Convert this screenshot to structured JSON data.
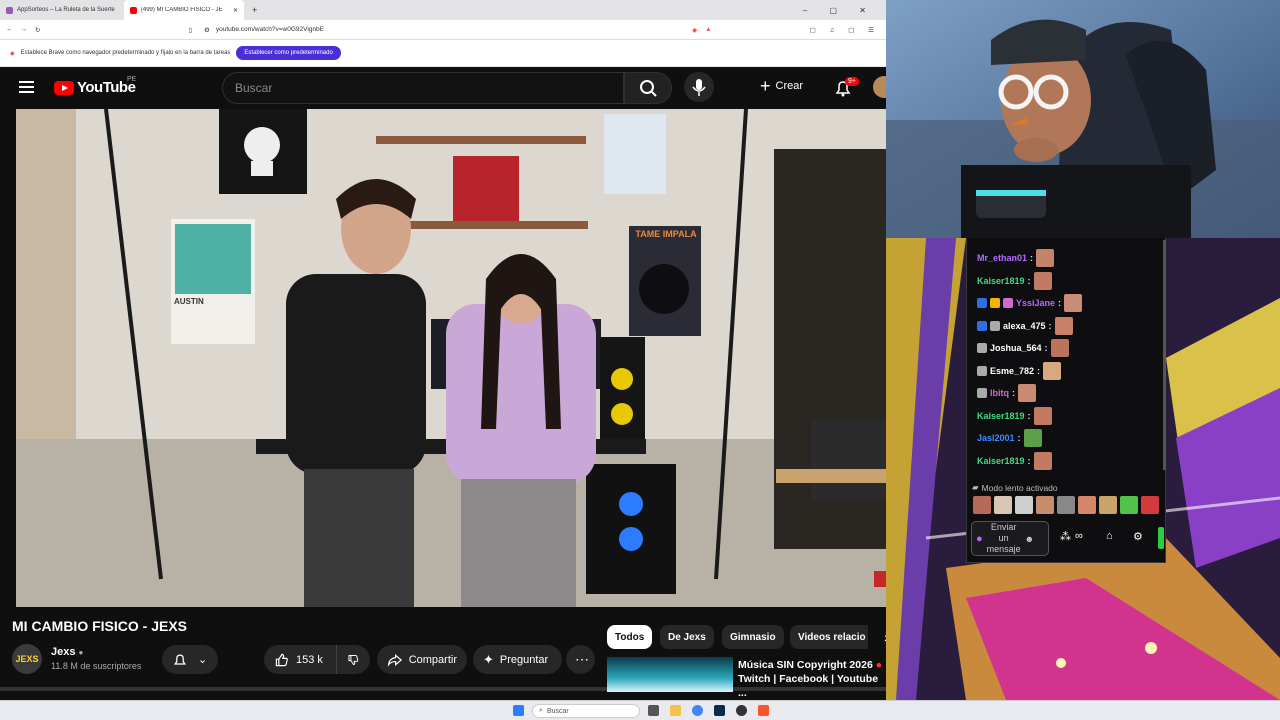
{
  "browser": {
    "tabs": [
      {
        "label": "AppSorteos – La Ruleta de la Suerte",
        "active": false
      },
      {
        "label": "(499) MI CAMBIO FISICO - JE",
        "active": true
      }
    ],
    "new_tab": "+",
    "url": "youtube.com/watch?v=w0G92VignbE",
    "infobar_text": "Establece Brave como navegador predeterminado y fíjalo en la barra de tareas",
    "infobar_button": "Establecer como predeterminado"
  },
  "youtube": {
    "logo": "YouTube",
    "region": "PE",
    "search_placeholder": "Buscar",
    "create_label": "Crear",
    "notif_count": "9+",
    "video_title": "MI CAMBIO FISICO - JEXS",
    "channel": {
      "avatar_text": "JEXS",
      "name": "Jexs",
      "subs": "11.8 M de suscriptores"
    },
    "likes": "153 k",
    "share": "Compartir",
    "ask": "Preguntar",
    "poster_text": "TAME IMPALA",
    "poster_text2": "AUSTIN",
    "chips": [
      "Todos",
      "De Jexs",
      "Gimnasio",
      "Videos relacio"
    ],
    "rec": {
      "line1": "Música SIN Copyright 2026",
      "line2": "Twitch | Facebook | Youtube ..."
    }
  },
  "chat": {
    "messages": [
      {
        "user": "Mr_ethan01",
        "color": "#b36bff",
        "badges": []
      },
      {
        "user": "Kaiser1819",
        "color": "#3ddc84",
        "badges": []
      },
      {
        "user": "YssiJane",
        "color": "#b36bff",
        "badges": [
          "#2d6ee0",
          "#f4b400",
          "#d06ad0"
        ]
      },
      {
        "user": "alexa_475",
        "color": "#ffffff",
        "badges": [
          "#2d6ee0",
          "#aaaaaa"
        ]
      },
      {
        "user": "Joshua_564",
        "color": "#ffffff",
        "badges": [
          "#aaaaaa"
        ]
      },
      {
        "user": "Esme_782",
        "color": "#ffffff",
        "badges": [
          "#aaaaaa"
        ]
      },
      {
        "user": "lbitq",
        "color": "#d06ad0",
        "badges": [
          "#aaaaaa"
        ]
      },
      {
        "user": "Kaiser1819",
        "color": "#3ddc84",
        "badges": []
      },
      {
        "user": "Jasl2001",
        "color": "#3d8bff",
        "badges": []
      },
      {
        "user": "Kaiser1819",
        "color": "#3ddc84",
        "badges": []
      }
    ],
    "slow_mode": "Modo lento activado",
    "input_placeholder": "Enviar un mensaje"
  },
  "taskbar": {
    "search_placeholder": "Buscar"
  },
  "colors": {
    "yt_red": "#ff0000",
    "bg": "#0f0f0f",
    "brave_purple": "#4b2fd6",
    "twitch_bg": "#0e0e10"
  }
}
